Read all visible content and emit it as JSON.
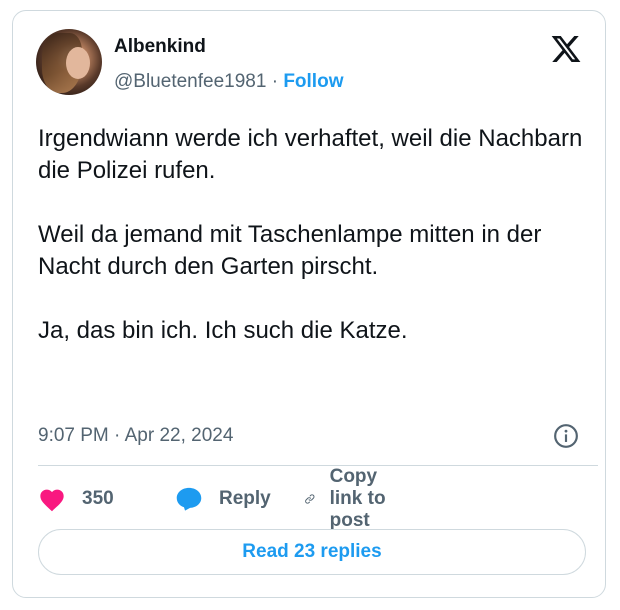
{
  "author": {
    "name": "Albenkind",
    "handle": "@Bluetenfee1981",
    "separator": "·",
    "follow_label": "Follow"
  },
  "tweet": {
    "paragraphs": [
      "Irgendwiann werde ich verhaftet, weil die Nachbarn die Polizei rufen.",
      "Weil da jemand mit Taschenlampe mitten in der Nacht durch den Garten pirscht.",
      "Ja, das bin ich. Ich such die Katze."
    ],
    "timestamp": "9:07 PM · Apr 22, 2024"
  },
  "actions": {
    "like_count": "350",
    "reply_label": "Reply",
    "copy_link_label": "Copy link to post"
  },
  "read_replies_label": "Read 23 replies",
  "colors": {
    "accent": "#1d9bf0",
    "like": "#f91880",
    "text": "#0f1419",
    "muted": "#536471",
    "border": "#cfd9de"
  },
  "icons": [
    "x-logo-icon",
    "info-icon",
    "heart-icon",
    "reply-bubble-icon",
    "link-icon"
  ]
}
